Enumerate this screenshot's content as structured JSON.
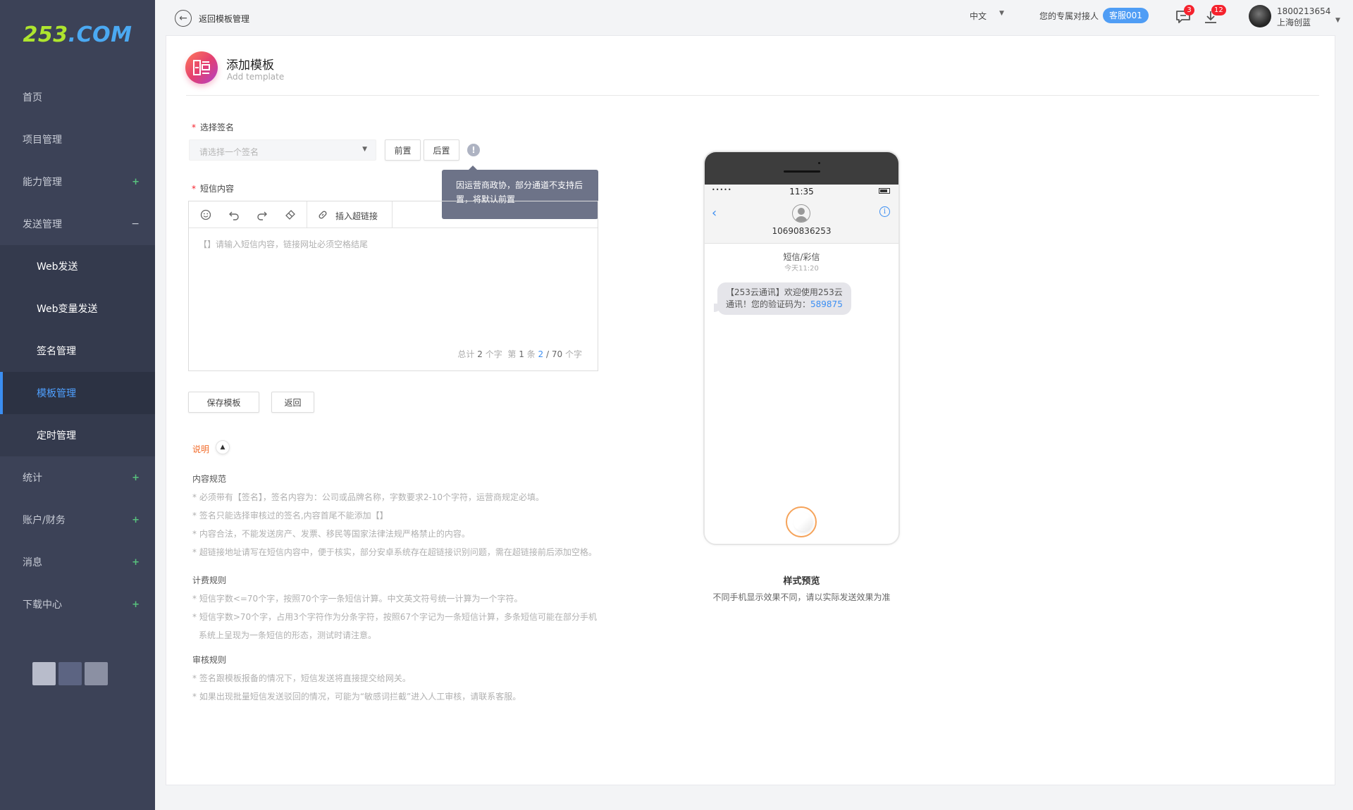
{
  "brand": {
    "logo_main": "253",
    "logo_tld": ".COM"
  },
  "sidebar": {
    "items": [
      {
        "label": "首页",
        "marker": ""
      },
      {
        "label": "项目管理",
        "marker": ""
      },
      {
        "label": "能力管理",
        "marker": "+"
      },
      {
        "label": "发送管理",
        "marker": "−"
      }
    ],
    "sub_items": [
      {
        "label": "Web发送"
      },
      {
        "label": "Web变量发送"
      },
      {
        "label": "签名管理"
      },
      {
        "label": "模板管理",
        "active": true
      },
      {
        "label": "定时管理"
      }
    ],
    "items_after": [
      {
        "label": "统计",
        "marker": "+"
      },
      {
        "label": "账户/财务",
        "marker": "+"
      },
      {
        "label": "消息",
        "marker": "+"
      },
      {
        "label": "下载中心",
        "marker": "+"
      }
    ],
    "theme_colors": [
      "#b8bccb",
      "#5c6482",
      "#8b90a3"
    ]
  },
  "topbar": {
    "back_label": "返回模板管理",
    "language": "中文",
    "agent_label": "您的专属对接人",
    "agent_name": "客服001",
    "messages_badge": "3",
    "downloads_badge": "12",
    "user_phone": "1800213654",
    "user_company": "上海创蓝"
  },
  "page": {
    "title": "添加模板",
    "subtitle": "Add template"
  },
  "form": {
    "signature_label": "选择签名",
    "signature_placeholder": "请选择一个签名",
    "prefix_button": "前置",
    "suffix_button": "后置",
    "info_icon": "!",
    "tooltip": "因运营商政协，部分通道不支持后置，将默认前置",
    "content_label": "短信内容",
    "insert_link_label": "插入超链接",
    "content_placeholder": "【】请输入短信内容，链接网址必须空格结尾",
    "count_prefix": "总计",
    "count_chars": "2",
    "count_char_unit": "个字",
    "count_seg_prefix": "第",
    "count_seg": "1",
    "count_seg_unit": "条",
    "count_current": "2",
    "count_sep": "/",
    "count_total": "70",
    "count_total_unit": "个字",
    "save_button": "保存模板",
    "back_button": "返回"
  },
  "notes": {
    "toggle_label": "说明",
    "sections": [
      {
        "title": "内容规范",
        "lines": [
          "* 必须带有【签名】，签名内容为：公司或品牌名称，字数要求2-10个字符，运营商规定必填。",
          "* 签名只能选择审核过的签名,内容首尾不能添加【】",
          "* 内容合法，不能发送房产、发票、移民等国家法律法规严格禁止的内容。",
          "* 超链接地址请写在短信内容中，便于核实，部分安卓系统存在超链接识别问题，需在超链接前后添加空格。"
        ]
      },
      {
        "title": "计费规则",
        "lines": [
          "* 短信字数<=70个字，按照70个字一条短信计算。中文英文符号统一计算为一个字符。",
          "* 短信字数>70个字，占用3个字符作为分条字符，按照67个字记为一条短信计算，多条短信可能在部分手机",
          "系统上呈现为一条短信的形态，测试时请注意。"
        ]
      },
      {
        "title": "审核规则",
        "lines": [
          "* 签名跟模板报备的情况下，短信发送将直接提交给网关。",
          "* 如果出现批量短信发送驳回的情况，可能为“敏感词拦截”进入人工审核，请联系客服。"
        ]
      }
    ]
  },
  "phone": {
    "signal_dots": "•••••",
    "time": "11:35",
    "back_icon": "‹",
    "info_icon": "i",
    "contact_number": "10690836253",
    "chat_type": "短信/彩信",
    "chat_time": "今天11:20",
    "bubble_text": "【253云通讯】欢迎使用253云通讯！您的验证码为：",
    "bubble_code": "589875"
  },
  "preview": {
    "title": "样式预览",
    "subtitle": "不同手机显示效果不同，请以实际发送效果为准"
  }
}
